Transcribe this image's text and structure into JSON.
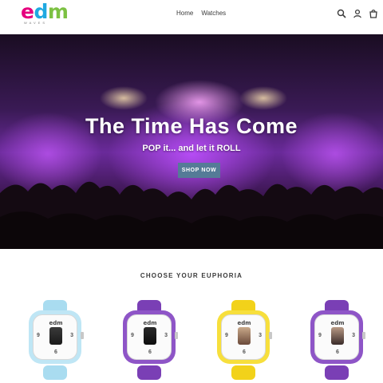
{
  "header": {
    "logo": {
      "text_e": "e",
      "text_d": "d",
      "text_m": "m",
      "tagline": "WAVES"
    },
    "nav": [
      {
        "label": "Home"
      },
      {
        "label": "Watches"
      }
    ],
    "icons": [
      "search-icon",
      "account-icon",
      "cart-icon"
    ]
  },
  "hero": {
    "title": "The Time Has Come",
    "subtitle": "POP it... and let it ROLL",
    "cta_label": "SHOP NOW",
    "cta_color": "#557b97"
  },
  "collection": {
    "title": "CHOOSE YOUR EUPHORIA",
    "watches": [
      {
        "logo": "edm",
        "num_12": "",
        "num_3": "3",
        "num_6": "6",
        "num_9": "9",
        "strap_color": "#a9dcf0",
        "case_color": "#bfe6f5"
      },
      {
        "logo": "edm",
        "num_12": "",
        "num_3": "3",
        "num_6": "6",
        "num_9": "9",
        "strap_color": "#7a3fb5",
        "case_color": "#8e55c7"
      },
      {
        "logo": "edm",
        "num_12": "",
        "num_3": "3",
        "num_6": "6",
        "num_9": "9",
        "strap_color": "#f2d21a",
        "case_color": "#f7df3c"
      },
      {
        "logo": "edm",
        "num_12": "",
        "num_3": "3",
        "num_6": "6",
        "num_9": "9",
        "strap_color": "#7a3fb5",
        "case_color": "#8e55c7"
      }
    ]
  }
}
